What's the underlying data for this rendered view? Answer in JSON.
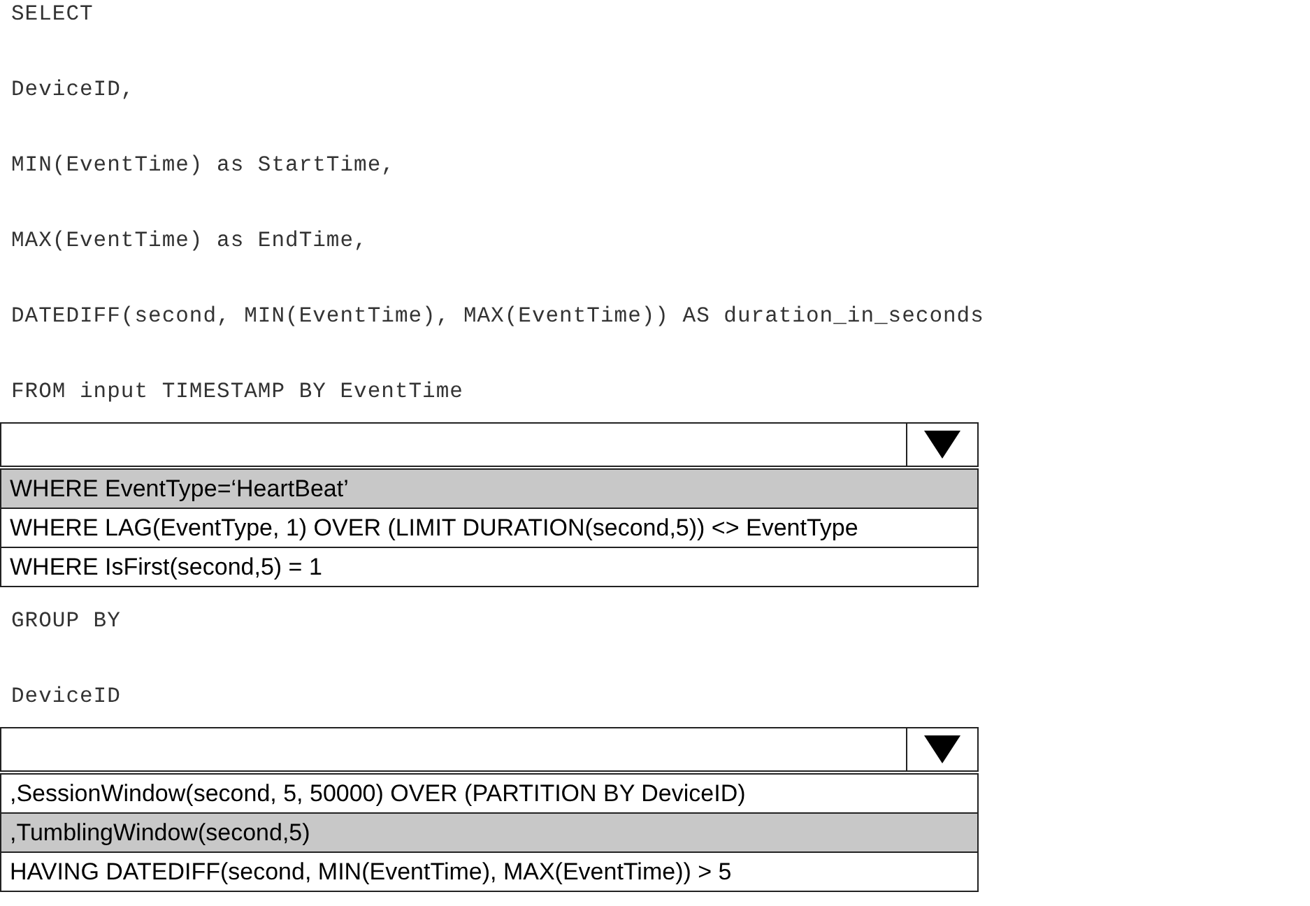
{
  "items": [
    {
      "kind": "code",
      "text": "SELECT"
    },
    {
      "kind": "code",
      "text": "DeviceID,"
    },
    {
      "kind": "code",
      "text": "MIN(EventTime) as StartTime,"
    },
    {
      "kind": "code",
      "text": "MAX(EventTime) as EndTime,"
    },
    {
      "kind": "code",
      "text": "DATEDIFF(second, MIN(EventTime), MAX(EventTime)) AS duration_in_seconds"
    },
    {
      "kind": "code",
      "text": "FROM input TIMESTAMP BY EventTime"
    },
    {
      "kind": "dropdown",
      "options": [
        {
          "text": "WHERE EventType=‘HeartBeat’",
          "selected": true
        },
        {
          "text": "WHERE LAG(EventType, 1) OVER (LIMIT DURATION(second,5)) <> EventType",
          "selected": false
        },
        {
          "text": "WHERE IsFirst(second,5) = 1",
          "selected": false
        }
      ]
    },
    {
      "kind": "code",
      "text": "GROUP BY"
    },
    {
      "kind": "code",
      "text": "DeviceID"
    },
    {
      "kind": "dropdown",
      "options": [
        {
          "text": ",SessionWindow(second, 5, 50000) OVER (PARTITION BY DeviceID)",
          "selected": false
        },
        {
          "text": ",TumblingWindow(second,5)",
          "selected": true
        },
        {
          "text": "HAVING DATEDIFF(second, MIN(EventTime), MAX(EventTime)) > 5",
          "selected": false
        }
      ]
    }
  ]
}
